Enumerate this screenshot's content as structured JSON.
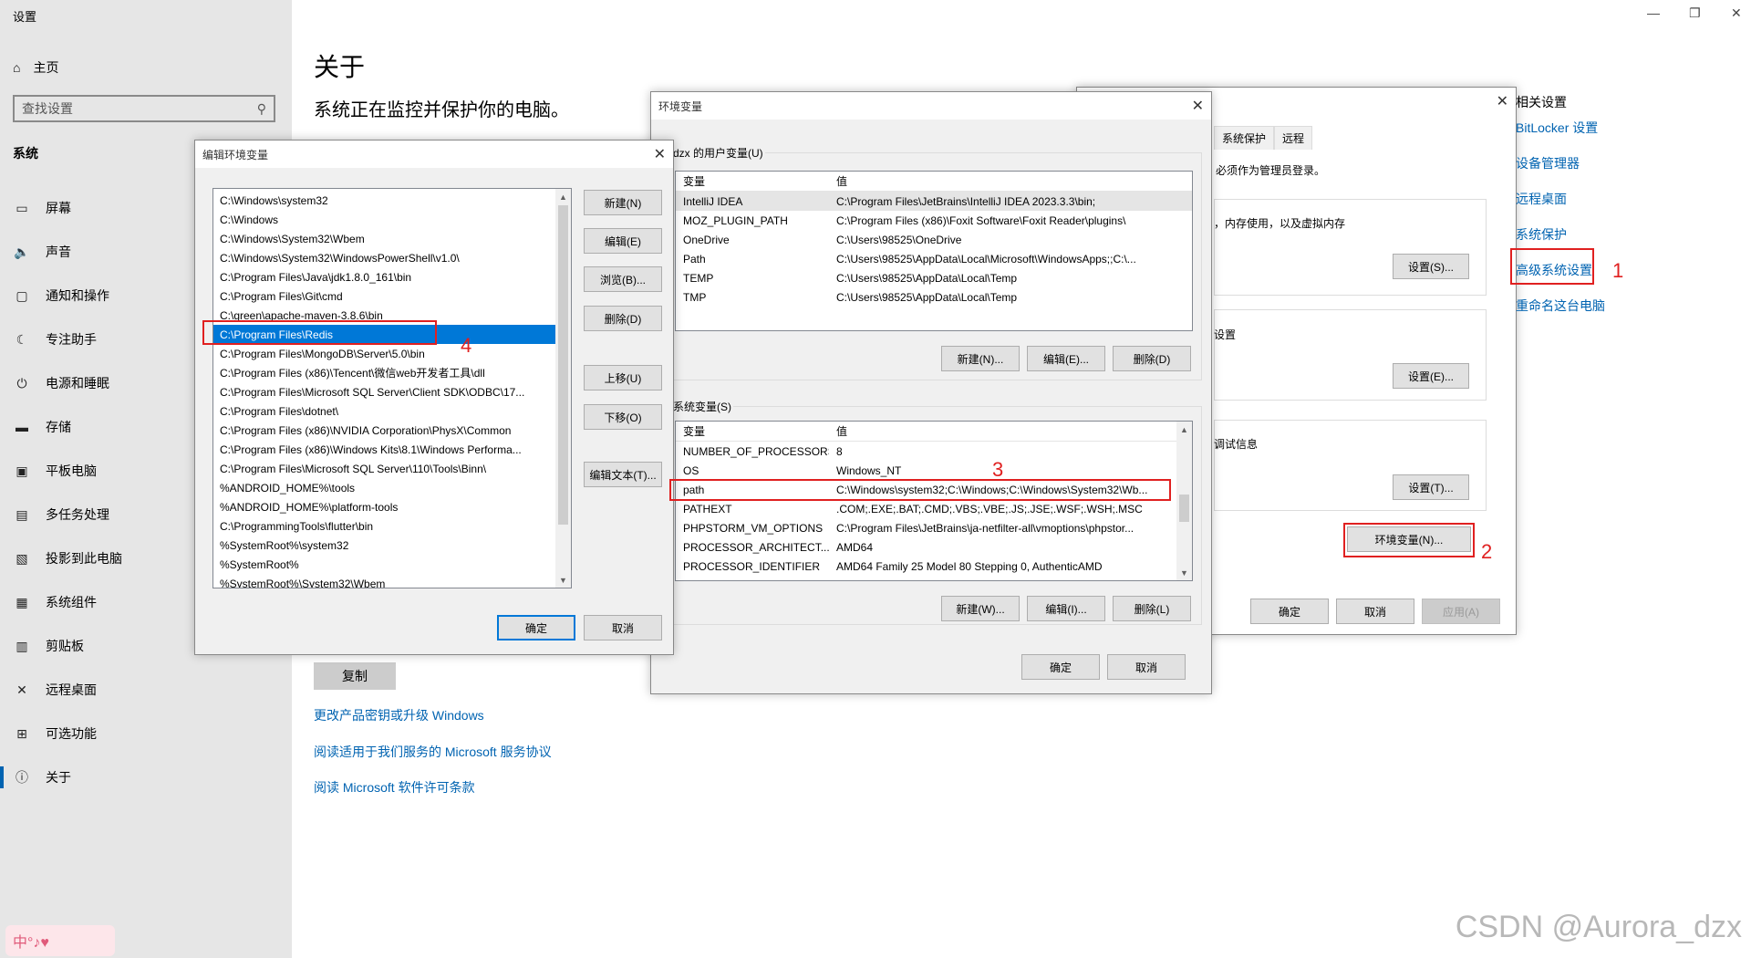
{
  "settings": {
    "app_title": "设置",
    "home": "主页",
    "search_placeholder": "查找设置",
    "section": "系统",
    "nav": [
      {
        "label": "屏幕",
        "icon": "monitor-icon",
        "glyph": "▭"
      },
      {
        "label": "声音",
        "icon": "speaker-icon",
        "glyph": "🔈"
      },
      {
        "label": "通知和操作",
        "icon": "notification-icon",
        "glyph": "▢"
      },
      {
        "label": "专注助手",
        "icon": "moon-icon",
        "glyph": "☾"
      },
      {
        "label": "电源和睡眠",
        "icon": "power-icon",
        "glyph": "⏻"
      },
      {
        "label": "存储",
        "icon": "storage-icon",
        "glyph": "▬"
      },
      {
        "label": "平板电脑",
        "icon": "tablet-icon",
        "glyph": "▣"
      },
      {
        "label": "多任务处理",
        "icon": "multitask-icon",
        "glyph": "▤"
      },
      {
        "label": "投影到此电脑",
        "icon": "project-icon",
        "glyph": "▧"
      },
      {
        "label": "系统组件",
        "icon": "components-icon",
        "glyph": "▦"
      },
      {
        "label": "剪贴板",
        "icon": "clipboard-icon",
        "glyph": "▥"
      },
      {
        "label": "远程桌面",
        "icon": "remote-icon",
        "glyph": "✕"
      },
      {
        "label": "可选功能",
        "icon": "features-icon",
        "glyph": "⊞"
      },
      {
        "label": "关于",
        "icon": "info-icon",
        "glyph": "ⓘ"
      }
    ],
    "page_title": "关于",
    "page_subtitle": "系统正在监控并保护你的电脑。",
    "copy_button": "复制",
    "links": [
      "更改产品密钥或升级 Windows",
      "阅读适用于我们服务的 Microsoft 服务协议",
      "阅读 Microsoft 软件许可条款"
    ],
    "related_title": "相关设置",
    "related_links": [
      "BitLocker 设置",
      "设备管理器",
      "远程桌面",
      "系统保护",
      "高级系统设置",
      "重命名这台电脑"
    ]
  },
  "sysprops": {
    "tabs": [
      "系统保护",
      "远程"
    ],
    "admin_note": "必须作为管理员登录。",
    "perf_text": "，内存使用，以及虚拟内存",
    "profile_text": "设置",
    "startup_text": "调试信息",
    "settings_s": "设置(S)...",
    "settings_e": "设置(E)...",
    "settings_t": "设置(T)...",
    "env_button": "环境变量(N)...",
    "ok": "确定",
    "cancel": "取消",
    "apply": "应用(A)"
  },
  "envvars": {
    "title": "环境变量",
    "user_group": "dzx 的用户变量(U)",
    "col_var": "变量",
    "col_val": "值",
    "user_vars": [
      {
        "name": "IntelliJ IDEA",
        "value": "C:\\Program Files\\JetBrains\\IntelliJ IDEA 2023.3.3\\bin;"
      },
      {
        "name": "MOZ_PLUGIN_PATH",
        "value": "C:\\Program Files (x86)\\Foxit Software\\Foxit Reader\\plugins\\"
      },
      {
        "name": "OneDrive",
        "value": "C:\\Users\\98525\\OneDrive"
      },
      {
        "name": "Path",
        "value": "C:\\Users\\98525\\AppData\\Local\\Microsoft\\WindowsApps;;C:\\..."
      },
      {
        "name": "TEMP",
        "value": "C:\\Users\\98525\\AppData\\Local\\Temp"
      },
      {
        "name": "TMP",
        "value": "C:\\Users\\98525\\AppData\\Local\\Temp"
      }
    ],
    "user_new": "新建(N)...",
    "user_edit": "编辑(E)...",
    "user_delete": "删除(D)",
    "sys_group": "系统变量(S)",
    "sys_vars": [
      {
        "name": "NUMBER_OF_PROCESSORS",
        "value": "8"
      },
      {
        "name": "OS",
        "value": "Windows_NT"
      },
      {
        "name": "path",
        "value": "C:\\Windows\\system32;C:\\Windows;C:\\Windows\\System32\\Wb..."
      },
      {
        "name": "PATHEXT",
        "value": ".COM;.EXE;.BAT;.CMD;.VBS;.VBE;.JS;.JSE;.WSF;.WSH;.MSC"
      },
      {
        "name": "PHPSTORM_VM_OPTIONS",
        "value": "C:\\Program Files\\JetBrains\\ja-netfilter-all\\vmoptions\\phpstor..."
      },
      {
        "name": "PROCESSOR_ARCHITECT...",
        "value": "AMD64"
      },
      {
        "name": "PROCESSOR_IDENTIFIER",
        "value": "AMD64 Family 25 Model 80 Stepping 0, AuthenticAMD"
      }
    ],
    "sys_new": "新建(W)...",
    "sys_edit": "编辑(I)...",
    "sys_delete": "删除(L)",
    "ok": "确定",
    "cancel": "取消"
  },
  "editenv": {
    "title": "编辑环境变量",
    "paths": [
      "C:\\Windows\\system32",
      "C:\\Windows",
      "C:\\Windows\\System32\\Wbem",
      "C:\\Windows\\System32\\WindowsPowerShell\\v1.0\\",
      "C:\\Program Files\\Java\\jdk1.8.0_161\\bin",
      "C:\\Program Files\\Git\\cmd",
      "C:\\green\\apache-maven-3.8.6\\bin",
      "C:\\Program Files\\Redis",
      "C:\\Program Files\\MongoDB\\Server\\5.0\\bin",
      "C:\\Program Files (x86)\\Tencent\\微信web开发者工具\\dll",
      "C:\\Program Files\\Microsoft SQL Server\\Client SDK\\ODBC\\17...",
      "C:\\Program Files\\dotnet\\",
      "C:\\Program Files (x86)\\NVIDIA Corporation\\PhysX\\Common",
      "C:\\Program Files (x86)\\Windows Kits\\8.1\\Windows Performa...",
      "C:\\Program Files\\Microsoft SQL Server\\110\\Tools\\Binn\\",
      "%ANDROID_HOME%\\tools",
      "%ANDROID_HOME%\\platform-tools",
      "C:\\ProgrammingTools\\flutter\\bin",
      "%SystemRoot%\\system32",
      "%SystemRoot%",
      "%SystemRoot%\\System32\\Wbem"
    ],
    "new": "新建(N)",
    "edit": "编辑(E)",
    "browse": "浏览(B)...",
    "delete": "删除(D)",
    "move_up": "上移(U)",
    "move_down": "下移(O)",
    "edit_text": "编辑文本(T)...",
    "ok": "确定",
    "cancel": "取消"
  },
  "annotations": [
    "1",
    "2",
    "3",
    "4"
  ],
  "watermark": "CSDN @Aurora_dzx",
  "ime_text": "中°♪♥"
}
